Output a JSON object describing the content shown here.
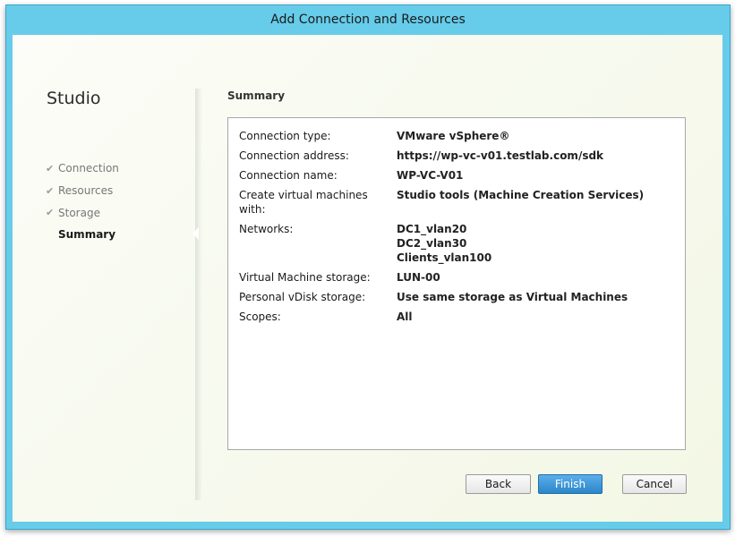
{
  "window": {
    "title": "Add Connection and Resources"
  },
  "sidebar": {
    "title": "Studio",
    "steps": [
      {
        "label": "Connection",
        "completed": true
      },
      {
        "label": "Resources",
        "completed": true
      },
      {
        "label": "Storage",
        "completed": true
      },
      {
        "label": "Summary",
        "completed": false,
        "current": true
      }
    ],
    "check_glyph": "✔"
  },
  "main": {
    "title": "Summary",
    "summary": {
      "connection_type": {
        "label": "Connection type:",
        "value": "VMware vSphere®"
      },
      "connection_address": {
        "label": "Connection address:",
        "value": "https://wp-vc-v01.testlab.com/sdk"
      },
      "connection_name": {
        "label": "Connection name:",
        "value": "WP-VC-V01"
      },
      "create_vms_with": {
        "label": "Create virtual machines with:",
        "value": "Studio tools (Machine Creation Services)"
      },
      "networks": {
        "label": "Networks:",
        "values": [
          "DC1_vlan20",
          "DC2_vlan30",
          "Clients_vlan100"
        ]
      },
      "vm_storage": {
        "label": "Virtual Machine storage:",
        "value": "LUN-00"
      },
      "pvd_storage": {
        "label": "Personal vDisk storage:",
        "value": "Use same storage as Virtual Machines"
      },
      "scopes": {
        "label": "Scopes:",
        "value": "All"
      }
    }
  },
  "buttons": {
    "back": "Back",
    "finish": "Finish",
    "cancel": "Cancel"
  },
  "colors": {
    "titlebar": "#66ccea",
    "primary_button": "#2c86c8"
  }
}
